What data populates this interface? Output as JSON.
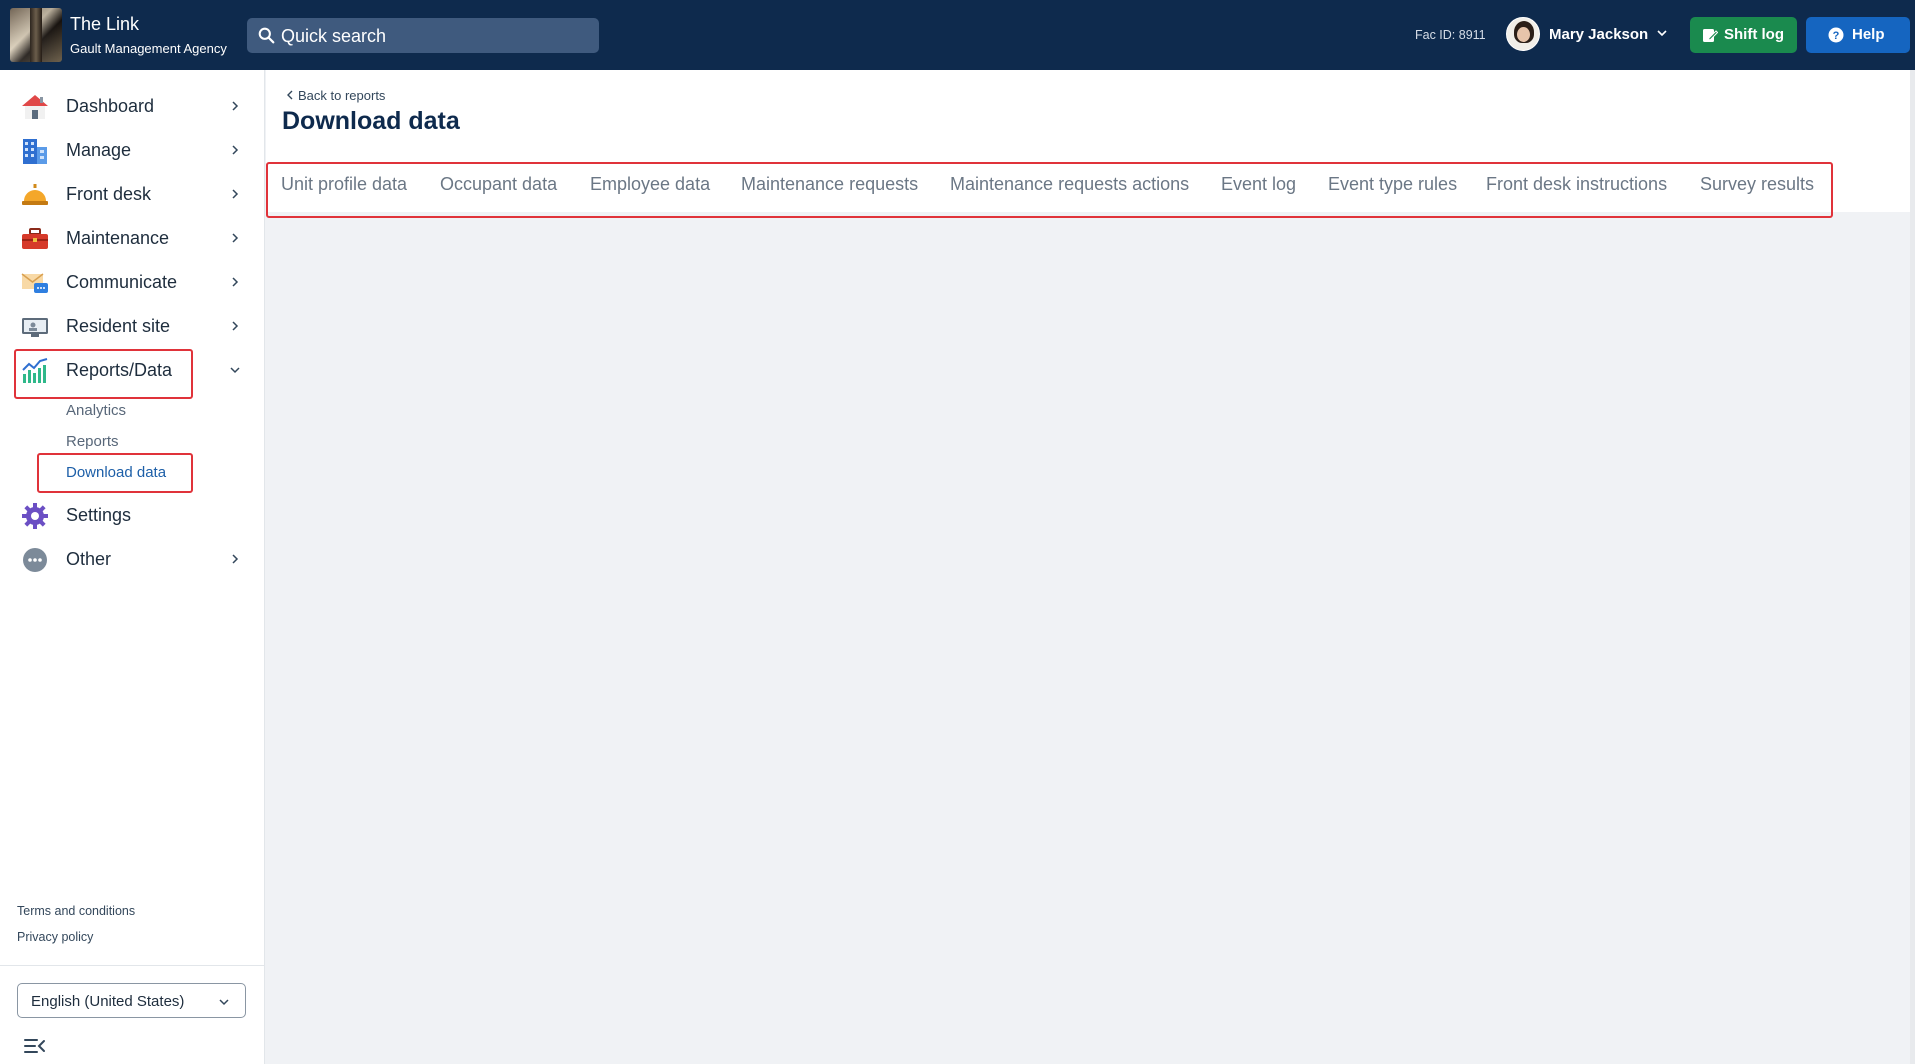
{
  "header": {
    "app_title": "The Link",
    "app_subtitle": "Gault Management Agency",
    "search_placeholder": "Quick search",
    "fac_id": "Fac ID: 8911",
    "user_name": "Mary Jackson",
    "shift_log_label": "Shift log",
    "help_label": "Help",
    "colors": {
      "bar": "#0e2a4d",
      "shift_log": "#1a8a4e",
      "help": "#1565c0"
    }
  },
  "sidebar": {
    "items": [
      {
        "label": "Dashboard",
        "icon": "house-icon"
      },
      {
        "label": "Manage",
        "icon": "building-icon"
      },
      {
        "label": "Front desk",
        "icon": "service-bell-icon"
      },
      {
        "label": "Maintenance",
        "icon": "toolbox-icon"
      },
      {
        "label": "Communicate",
        "icon": "envelope-chat-icon"
      },
      {
        "label": "Resident site",
        "icon": "monitor-icon"
      },
      {
        "label": "Reports/Data",
        "icon": "bar-chart-icon"
      },
      {
        "label": "Settings",
        "icon": "gear-icon"
      },
      {
        "label": "Other",
        "icon": "more-dots-icon"
      }
    ],
    "reports_sub": [
      "Analytics",
      "Reports",
      "Download data"
    ],
    "active_sub": "Download data",
    "footer_links": [
      "Terms and conditions",
      "Privacy policy"
    ],
    "language": "English (United States)"
  },
  "main": {
    "back_link": "Back to reports",
    "title": "Download data",
    "tabs": [
      "Unit profile data",
      "Occupant data",
      "Employee data",
      "Maintenance requests",
      "Maintenance requests actions",
      "Event log",
      "Event type rules",
      "Front desk instructions",
      "Survey results"
    ]
  },
  "highlight_color": "#e0333a"
}
